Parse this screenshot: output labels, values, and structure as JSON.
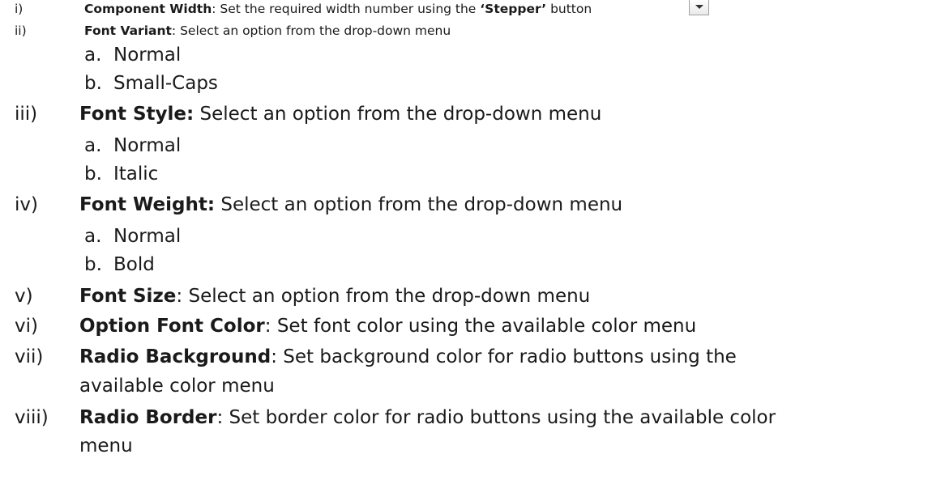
{
  "items": [
    {
      "num": "i)",
      "label": "Component Width",
      "sep": ": ",
      "text_a": "Set the required width number using the ",
      "quoted": "‘Stepper’",
      "text_b": " button",
      "icon": "chevron-down-icon"
    },
    {
      "num": "ii)",
      "label": "Font Variant",
      "sep": ": ",
      "text": "Select an option from the drop-down menu",
      "subs": [
        {
          "l": "a.",
          "t": "Normal"
        },
        {
          "l": "b.",
          "t": "Small-Caps"
        }
      ]
    },
    {
      "num": "iii)",
      "label": "Font Style:",
      "sep": " ",
      "text": "Select an option from the drop-down menu",
      "subs": [
        {
          "l": "a.",
          "t": "Normal"
        },
        {
          "l": "b.",
          "t": "Italic"
        }
      ]
    },
    {
      "num": "iv)",
      "label": "Font Weight:",
      "sep": " ",
      "text": "Select an option from the drop-down menu",
      "subs": [
        {
          "l": "a.",
          "t": "Normal"
        },
        {
          "l": "b.",
          "t": "Bold"
        }
      ]
    },
    {
      "num": "v)",
      "label": "Font Size",
      "sep": ": ",
      "text": "Select an option from the drop-down menu"
    },
    {
      "num": "vi)",
      "label": "Option Font Color",
      "sep": ": ",
      "text": "Set font color using the available color menu"
    },
    {
      "num": "vii)",
      "label": "Radio Background",
      "sep": ": ",
      "text": "Set background color for radio buttons using the",
      "cont": "available color menu"
    },
    {
      "num": "viii)",
      "label": "Radio Border",
      "sep": ": ",
      "text": "Set border color for radio buttons using the available color",
      "cont": "menu"
    }
  ]
}
